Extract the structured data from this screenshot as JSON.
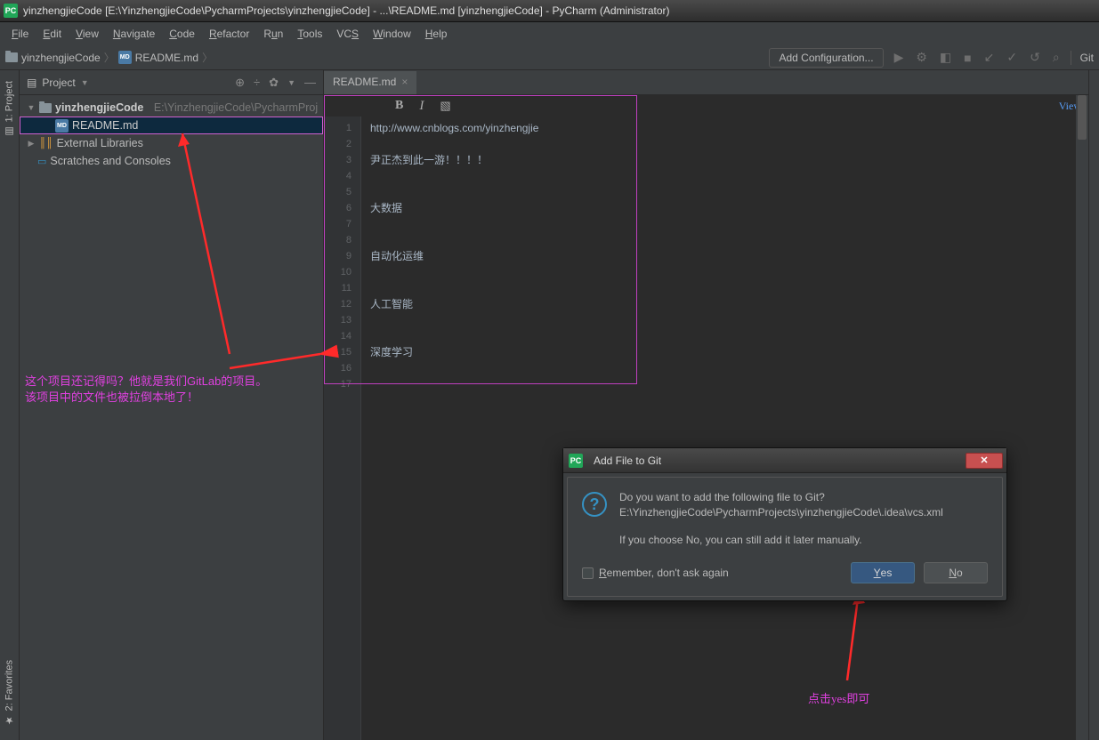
{
  "window_title": "yinzhengjieCode [E:\\YinzhengjieCode\\PycharmProjects\\yinzhengjieCode] - ...\\README.md [yinzhengjieCode] - PyCharm (Administrator)",
  "app_icon_label": "PC",
  "menu": {
    "file": "File",
    "edit": "Edit",
    "view": "View",
    "navigate": "Navigate",
    "code": "Code",
    "refactor": "Refactor",
    "run": "Run",
    "tools": "Tools",
    "vcs": "VCS",
    "window": "Window",
    "help": "Help"
  },
  "breadcrumb": {
    "root": "yinzhengjieCode",
    "file": "README.md",
    "md_badge": "MD"
  },
  "add_config": "Add Configuration...",
  "right_tool": "Git",
  "sidebar": {
    "title": "Project",
    "left_tabs": {
      "project": "1: Project",
      "favorites": "2: Favorites"
    },
    "root": {
      "name": "yinzhengjieCode",
      "path": "E:\\YinzhengjieCode\\PycharmProj"
    },
    "file": "README.md",
    "external": "External Libraries",
    "scratches": "Scratches and Consoles"
  },
  "editor": {
    "tab": "README.md",
    "view": "View",
    "lines": [
      "http://www.cnblogs.com/yinzhengjie",
      "",
      "尹正杰到此一游！！！！",
      "",
      "",
      "大数据",
      "",
      "",
      "自动化运维",
      "",
      "",
      "人工智能",
      "",
      "",
      "深度学习",
      "",
      ""
    ],
    "line_count": 17
  },
  "dialog": {
    "title": "Add File to Git",
    "msg1": "Do you want to add the following file to Git?",
    "path": "E:\\YinzhengjieCode\\PycharmProjects\\yinzhengjieCode\\.idea\\vcs.xml",
    "msg2": "If you choose No, you can still add it later manually.",
    "remember": "Remember, don't ask again",
    "yes": "Yes",
    "no": "No"
  },
  "annotations": {
    "a1_l1": "这个项目还记得吗？他就是我们GitLab的项目。",
    "a1_l2": "该项目中的文件也被拉倒本地了！",
    "a2": "点击yes即可"
  }
}
